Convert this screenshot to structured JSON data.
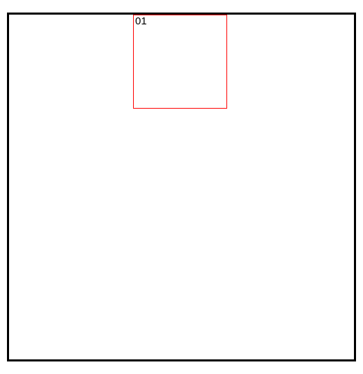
{
  "diagram": {
    "inner_box_label": "01",
    "colors": {
      "outer_border": "#000000",
      "inner_border": "#ff0000",
      "background": "#ffffff"
    }
  }
}
